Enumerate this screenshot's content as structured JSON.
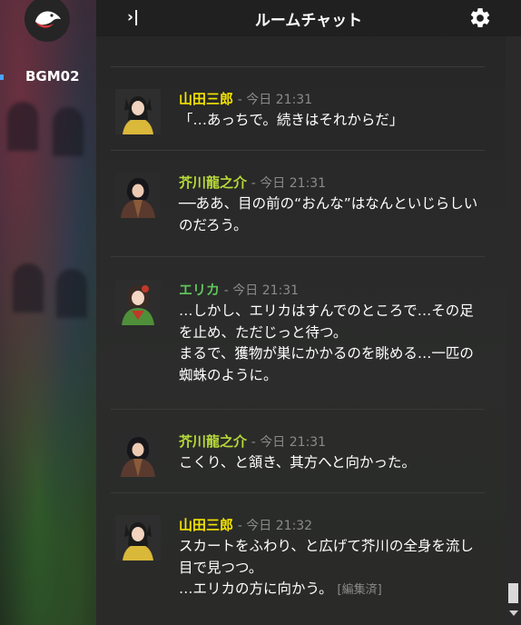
{
  "sidebar": {
    "bgm_label": "BGM02",
    "logo_icon": "bird-icon"
  },
  "header": {
    "collapse_label": "›|",
    "title": "ルームチャット",
    "settings_icon": "gear-icon"
  },
  "messages": [
    {
      "name": "山田三郎",
      "name_color": "#f2e200",
      "time": "- 今日 21:31",
      "body": "「…あっちで。続きはそれからだ」",
      "edited": ""
    },
    {
      "name": "芥川龍之介",
      "name_color": "#b7d93a",
      "time": "- 今日 21:31",
      "body": "──ああ、目の前の“おんな”はなんといじらしいのだろう。",
      "edited": ""
    },
    {
      "name": "エリカ",
      "name_color": "#5fc35a",
      "time": "- 今日 21:31",
      "body": "…しかし、エリカはすんでのところで…その足を止め、ただじっと待つ。\nまるで、獲物が巣にかかるのを眺める…一匹の蜘蛛のように。",
      "edited": ""
    },
    {
      "name": "芥川龍之介",
      "name_color": "#b7d93a",
      "time": "- 今日 21:31",
      "body": "こくり、と頷き、其方へと向かった。",
      "edited": ""
    },
    {
      "name": "山田三郎",
      "name_color": "#f2e200",
      "time": "- 今日 21:32",
      "body": "スカートをふわり、と広げて芥川の全身を流し目で見つつ。\n…エリカの方に向かう。",
      "edited": "[編集済]"
    }
  ]
}
